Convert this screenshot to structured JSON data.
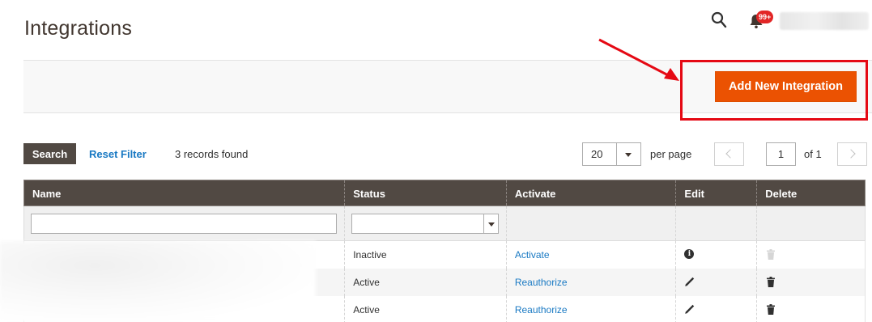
{
  "page": {
    "title": "Integrations"
  },
  "header": {
    "notifications_badge": "99+"
  },
  "actions": {
    "add_button_label": "Add New Integration"
  },
  "grid_toolbar": {
    "search_label": "Search",
    "reset_filter_label": "Reset Filter",
    "records_found": "3 records found",
    "per_page_value": "20",
    "per_page_label": "per page",
    "current_page": "1",
    "of_pages": "of 1"
  },
  "table": {
    "columns": [
      "Name",
      "Status",
      "Activate",
      "Edit",
      "Delete"
    ],
    "rows": [
      {
        "status": "Inactive",
        "activate": "Activate",
        "edit_icon": "info-icon",
        "delete_icon": "trash-icon-disabled"
      },
      {
        "status": "Active",
        "activate": "Reauthorize",
        "edit_icon": "pencil-icon",
        "delete_icon": "trash-icon"
      },
      {
        "status": "Active",
        "activate": "Reauthorize",
        "edit_icon": "pencil-icon",
        "delete_icon": "trash-icon"
      }
    ]
  },
  "colors": {
    "accent": "#eb5202",
    "grid_header": "#514943",
    "link": "#1979c3",
    "annotation": "#e50914"
  }
}
